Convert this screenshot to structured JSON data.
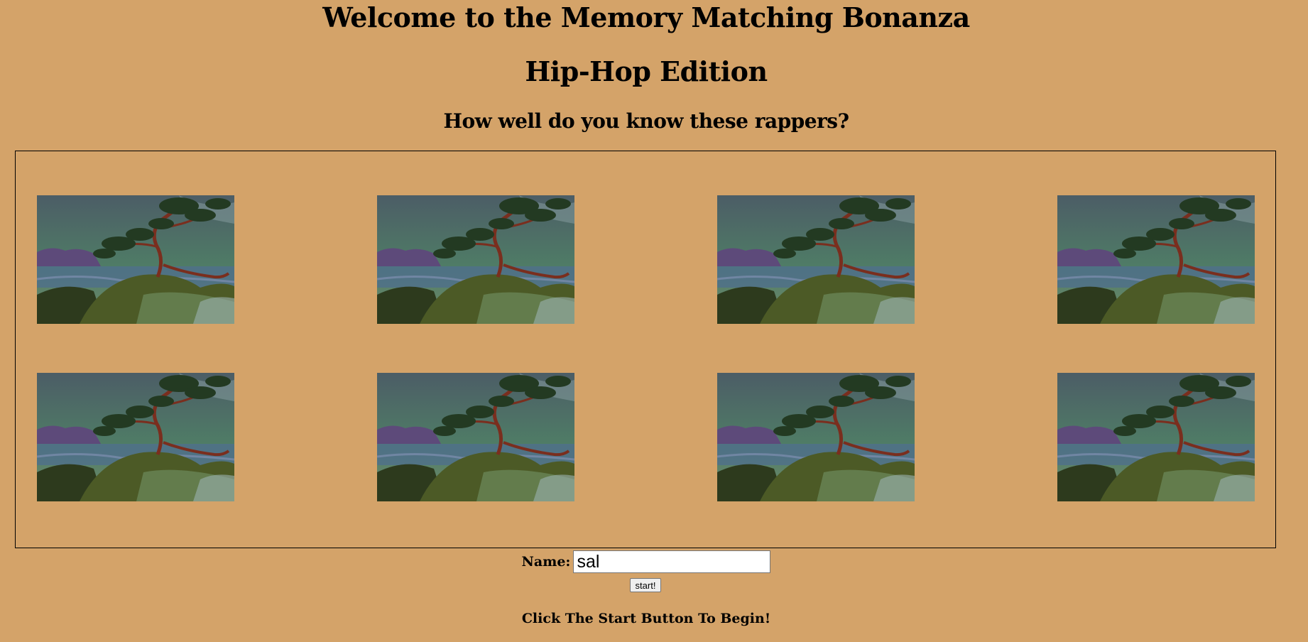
{
  "header": {
    "title": "Welcome to the Memory Matching Bonanza",
    "subtitle": "Hip-Hop Edition",
    "prompt": "How well do you know these rappers?"
  },
  "board": {
    "cards": [
      {
        "face": "hidden",
        "image": "tree-landscape-card-back"
      },
      {
        "face": "hidden",
        "image": "tree-landscape-card-back"
      },
      {
        "face": "hidden",
        "image": "tree-landscape-card-back"
      },
      {
        "face": "hidden",
        "image": "tree-landscape-card-back"
      },
      {
        "face": "hidden",
        "image": "tree-landscape-card-back"
      },
      {
        "face": "hidden",
        "image": "tree-landscape-card-back"
      },
      {
        "face": "hidden",
        "image": "tree-landscape-card-back"
      },
      {
        "face": "hidden",
        "image": "tree-landscape-card-back"
      }
    ]
  },
  "form": {
    "name_label": "Name:",
    "name_value": "sal",
    "start_label": "start!"
  },
  "status": "Click The Start Button To Begin!",
  "colors": {
    "background": "#d4a369",
    "sky": "#4f7c66",
    "trunk": "#7a2e1e"
  }
}
